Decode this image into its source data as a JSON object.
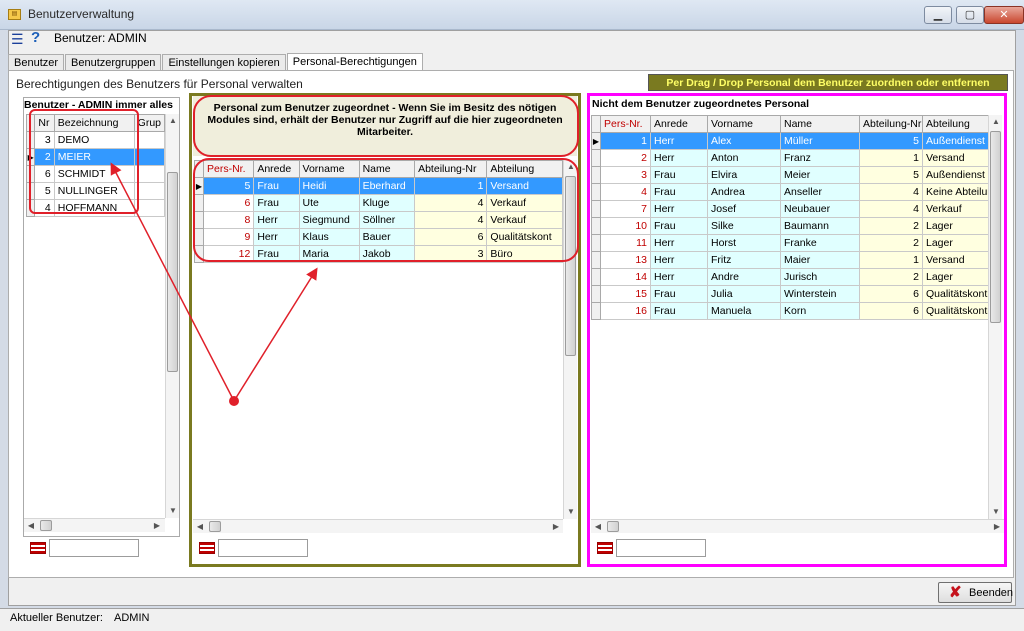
{
  "window": {
    "title": "Benutzerverwaltung",
    "minimize": "▁",
    "maximize": "▢",
    "close": "✕"
  },
  "header": {
    "icon1": "list-icon",
    "icon2": "help-icon",
    "help_glyph": "?",
    "label": "Benutzer: ADMIN"
  },
  "tabs": [
    {
      "label": "Benutzer"
    },
    {
      "label": "Benutzergruppen"
    },
    {
      "label": "Einstellungen kopieren"
    },
    {
      "label": "Personal-Berechtigungen"
    }
  ],
  "section_title": "Berechtigungen des Benutzers für Personal verwalten",
  "hint_banner": "Per Drag / Drop Personal dem Benutzer zuordnen oder entfernen",
  "users": {
    "title": "Benutzer - ADMIN immer alles",
    "cols": [
      "Nr",
      "Bezeichnung",
      "Grup"
    ],
    "rows": [
      {
        "nr": "3",
        "name": "DEMO"
      },
      {
        "nr": "2",
        "name": "MEIER"
      },
      {
        "nr": "6",
        "name": "SCHMIDT"
      },
      {
        "nr": "5",
        "name": "NULLINGER"
      },
      {
        "nr": "4",
        "name": "HOFFMANN"
      }
    ]
  },
  "assigned": {
    "title": "Personal zum Benutzer zugeordnet - Wenn Sie im Besitz des nötigen Modules sind, erhält der Benutzer nur Zugriff auf die hier zugeordneten Mitarbeiter.",
    "cols": [
      "Pers-Nr.",
      "Anrede",
      "Vorname",
      "Name",
      "Abteilung-Nr",
      "Abteilung"
    ],
    "rows": [
      [
        "5",
        "Frau",
        "Heidi",
        "Eberhard",
        "1",
        "Versand"
      ],
      [
        "6",
        "Frau",
        "Ute",
        "Kluge",
        "4",
        "Verkauf"
      ],
      [
        "8",
        "Herr",
        "Siegmund",
        "Söllner",
        "4",
        "Verkauf"
      ],
      [
        "9",
        "Herr",
        "Klaus",
        "Bauer",
        "6",
        "Qualitätskont"
      ],
      [
        "12",
        "Frau",
        "Maria",
        "Jakob",
        "3",
        "Büro"
      ]
    ]
  },
  "unassigned": {
    "title": "Nicht dem Benutzer zugeordnetes Personal",
    "cols": [
      "Pers-Nr.",
      "Anrede",
      "Vorname",
      "Name",
      "Abteilung-Nr",
      "Abteilung"
    ],
    "rows": [
      [
        "1",
        "Herr",
        "Alex",
        "Müller",
        "5",
        "Außendienst"
      ],
      [
        "2",
        "Herr",
        "Anton",
        "Franz",
        "1",
        "Versand"
      ],
      [
        "3",
        "Frau",
        "Elvira",
        "Meier",
        "5",
        "Außendienst"
      ],
      [
        "4",
        "Frau",
        "Andrea",
        "Anseller",
        "4",
        "Keine Abteilun"
      ],
      [
        "7",
        "Herr",
        "Josef",
        "Neubauer",
        "4",
        "Verkauf"
      ],
      [
        "10",
        "Frau",
        "Silke",
        "Baumann",
        "2",
        "Lager"
      ],
      [
        "11",
        "Herr",
        "Horst",
        "Franke",
        "2",
        "Lager"
      ],
      [
        "13",
        "Herr",
        "Fritz",
        "Maier",
        "1",
        "Versand"
      ],
      [
        "14",
        "Herr",
        "Andre",
        "Jurisch",
        "2",
        "Lager"
      ],
      [
        "15",
        "Frau",
        "Julia",
        "Winterstein",
        "6",
        "Qualitätskontr"
      ],
      [
        "16",
        "Frau",
        "Manuela",
        "Korn",
        "6",
        "Qualitätskontr"
      ]
    ]
  },
  "close_button": {
    "label": "Beenden",
    "icon": "red-x-icon"
  },
  "status": {
    "label": "Aktueller Benutzer:",
    "value": "ADMIN"
  },
  "colors": {
    "selection": "#3399ff",
    "pers_nr": "#c00000",
    "annotation_red": "#e0202a",
    "assigned_frame": "#7a7a20",
    "unassigned_frame": "#ff00ff",
    "banner_bg": "#7a7a20",
    "banner_text": "#ffff66"
  }
}
